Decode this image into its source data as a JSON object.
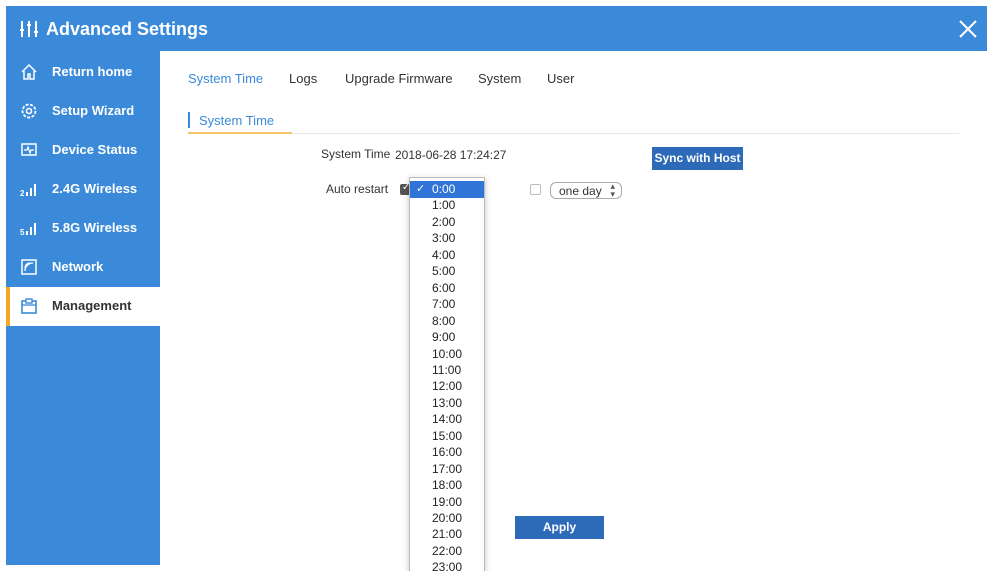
{
  "window": {
    "title": "Advanced Settings"
  },
  "sidebar": {
    "items": [
      {
        "label": "Return home",
        "icon": "home-icon"
      },
      {
        "label": "Setup Wizard",
        "icon": "gear-icon"
      },
      {
        "label": "Device Status",
        "icon": "monitor-icon"
      },
      {
        "label": "2.4G Wireless",
        "icon": "signal-2g-icon"
      },
      {
        "label": "5.8G Wireless",
        "icon": "signal-5g-icon"
      },
      {
        "label": "Network",
        "icon": "network-icon"
      },
      {
        "label": "Management",
        "icon": "clipboard-icon",
        "active": true
      }
    ]
  },
  "tabs": [
    "System Time",
    "Logs",
    "Upgrade Firmware",
    "System",
    "User"
  ],
  "subtab": {
    "label": "System Time"
  },
  "system_time": {
    "label": "System Time",
    "value": "2018-06-28 17:24:27",
    "sync_label": "Sync with Host"
  },
  "auto_restart": {
    "label": "Auto restart",
    "checked": true,
    "selected_hour": "0:00",
    "period_checked": false,
    "period_value": "one day"
  },
  "hours": [
    "0:00",
    "1:00",
    "2:00",
    "3:00",
    "4:00",
    "5:00",
    "6:00",
    "7:00",
    "8:00",
    "9:00",
    "10:00",
    "11:00",
    "12:00",
    "13:00",
    "14:00",
    "15:00",
    "16:00",
    "17:00",
    "18:00",
    "19:00",
    "20:00",
    "21:00",
    "22:00",
    "23:00"
  ],
  "apply_label": "Apply",
  "colors": {
    "accent": "#3a8ad9",
    "button": "#2d6ab8",
    "active_marker": "#f5a623",
    "selected_option": "#2f74d6"
  }
}
